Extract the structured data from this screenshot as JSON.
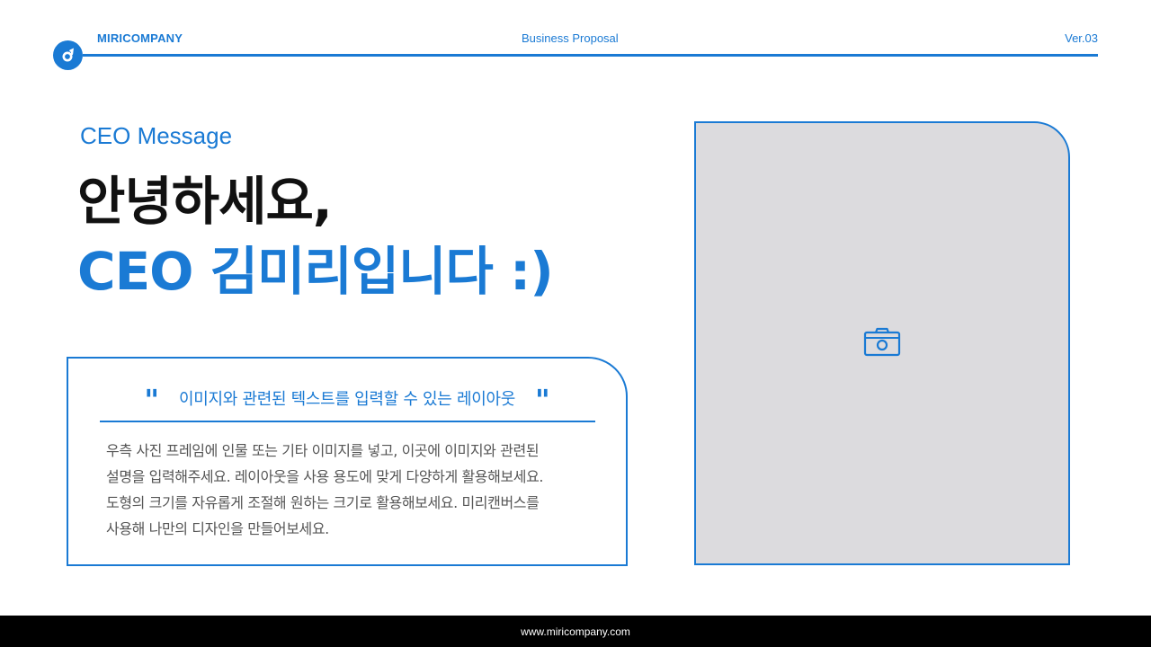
{
  "header": {
    "brand": "MIRICOMPANY",
    "center": "Business Proposal",
    "version": "Ver.03",
    "logo_icon": "company-logo-icon"
  },
  "hero": {
    "eyebrow": "CEO Message",
    "line1": "안녕하세요,",
    "line2": "CEO 김미리입니다 :)"
  },
  "quote": {
    "open_mark": "\"",
    "close_mark": "\"",
    "title": "이미지와 관련된 텍스트를 입력할 수 있는 레이아웃",
    "body": [
      "우측 사진 프레임에 인물 또는 기타 이미지를 넣고, 이곳에 이미지와 관련된",
      "설명을 입력해주세요. 레이아웃을 사용 용도에 맞게 다양하게 활용해보세요.",
      "도형의 크기를 자유롭게 조절해 원하는 크기로 활용해보세요. 미리캔버스를",
      "사용해 나만의 디자인을 만들어보세요."
    ]
  },
  "photo": {
    "icon": "camera-icon"
  },
  "footer": {
    "url": "www.miricompany.com"
  },
  "colors": {
    "accent": "#1a7ad4",
    "dark": "#111111",
    "body_text": "#555555",
    "photo_bg": "#dcdbde",
    "footer_bg": "#000000"
  }
}
